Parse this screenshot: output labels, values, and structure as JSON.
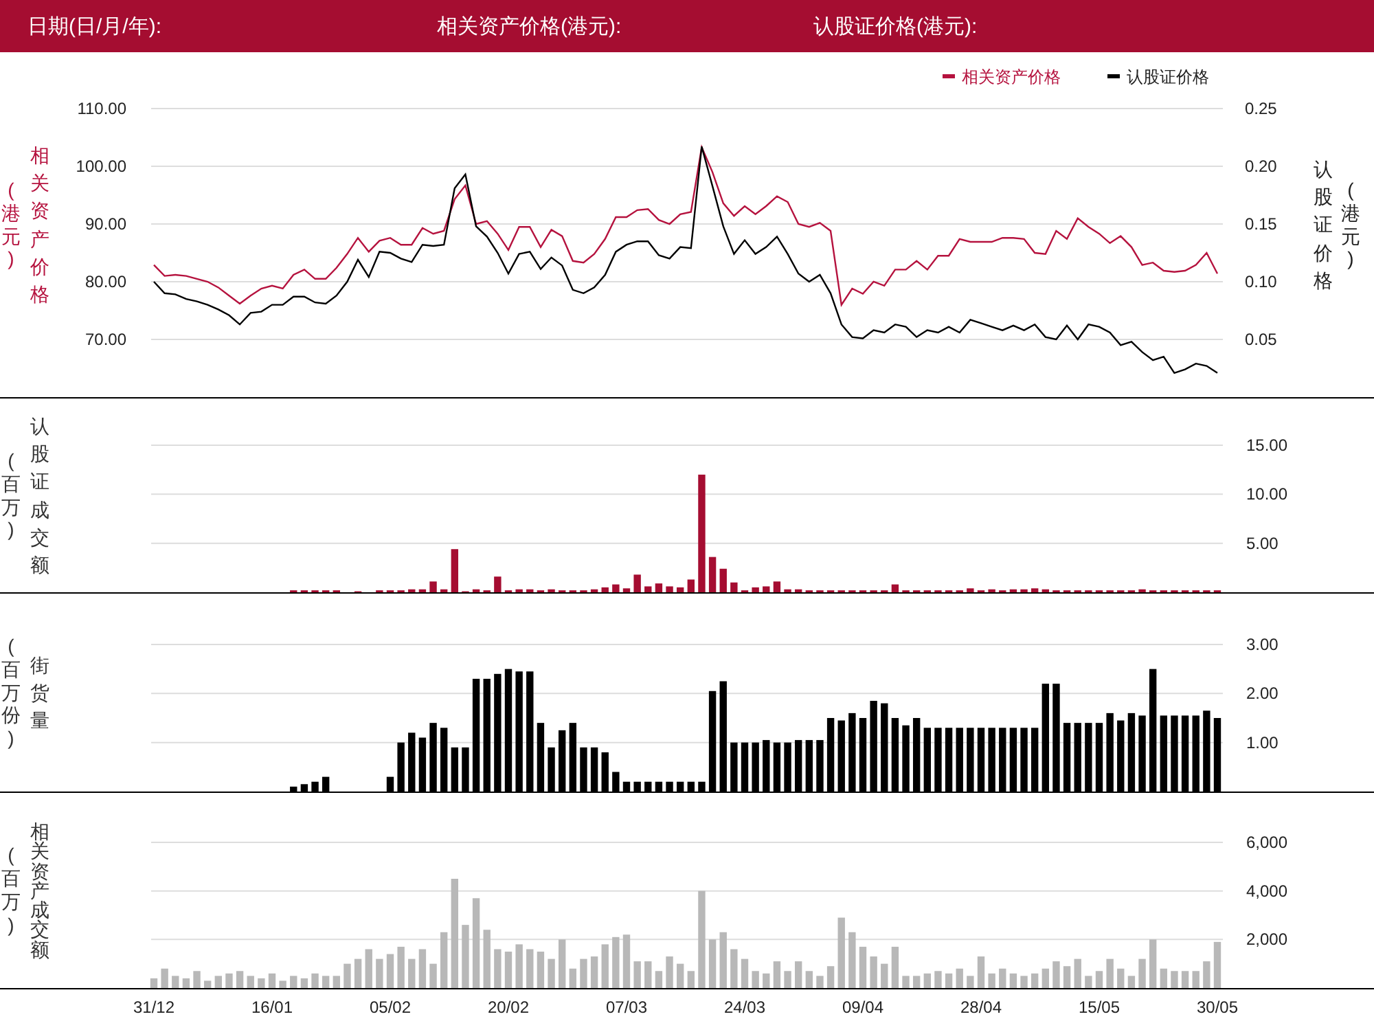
{
  "header": {
    "fields": [
      {
        "label": "日期(日/月/年):"
      },
      {
        "label": "相关资产价格(港元):"
      },
      {
        "label": "认股证价格(港元):"
      }
    ]
  },
  "panels": [
    {
      "left_unit": "(港元)",
      "right_unit": "(港元)",
      "chart_data": {
        "type": "line",
        "ylabel": "相关资产价格",
        "y2label": "认股证价格",
        "grid": true,
        "legend": true,
        "ylim": [
          60,
          110
        ],
        "y2lim": [
          0,
          0.25
        ],
        "yticks": [
          {
            "value": 70,
            "label": "70.00"
          },
          {
            "value": 80,
            "label": "80.00"
          },
          {
            "value": 90,
            "label": "90.00"
          },
          {
            "value": 100,
            "label": "100.00"
          },
          {
            "value": 110,
            "label": "110.00"
          }
        ],
        "y2ticks": [
          {
            "value": 0.05,
            "label": "0.05"
          },
          {
            "value": 0.1,
            "label": "0.10"
          },
          {
            "value": 0.15,
            "label": "0.15"
          },
          {
            "value": 0.2,
            "label": "0.20"
          },
          {
            "value": 0.25,
            "label": "0.25"
          }
        ],
        "series": [
          {
            "name": "相关资产价格",
            "color": "#b5123e",
            "values": [
              82.9,
              81.0,
              81.2,
              81.0,
              80.5,
              80.0,
              79.0,
              77.6,
              76.2,
              77.6,
              78.8,
              79.3,
              78.8,
              81.2,
              82.1,
              80.5,
              80.5,
              82.4,
              84.8,
              87.6,
              85.2,
              87.1,
              87.6,
              86.4,
              86.4,
              89.3,
              88.3,
              88.8,
              94.3,
              96.7,
              90.0,
              90.5,
              88.3,
              85.5,
              89.5,
              89.5,
              86.0,
              89.0,
              87.9,
              83.6,
              83.3,
              84.8,
              87.4,
              91.2,
              91.2,
              92.4,
              92.6,
              90.7,
              90.0,
              91.7,
              92.1,
              103.3,
              99.0,
              93.6,
              91.4,
              93.1,
              91.7,
              93.1,
              94.8,
              93.8,
              90.0,
              89.5,
              90.2,
              88.8,
              76.0,
              78.8,
              77.9,
              80.0,
              79.3,
              82.1,
              82.1,
              83.6,
              82.1,
              84.5,
              84.5,
              87.4,
              86.9,
              86.9,
              86.9,
              87.6,
              87.6,
              87.4,
              85.0,
              84.8,
              88.8,
              87.4,
              91.0,
              89.5,
              88.3,
              86.7,
              87.9,
              86.0,
              82.9,
              83.3,
              81.9,
              81.7,
              81.9,
              82.9,
              85.0,
              81.4
            ]
          },
          {
            "name": "认股证价格",
            "color": "#000000",
            "axis": "y2",
            "values": [
              0.1,
              0.09,
              0.089,
              0.085,
              0.083,
              0.08,
              0.076,
              0.071,
              0.063,
              0.073,
              0.074,
              0.08,
              0.08,
              0.087,
              0.087,
              0.082,
              0.081,
              0.088,
              0.1,
              0.119,
              0.104,
              0.126,
              0.125,
              0.12,
              0.117,
              0.132,
              0.131,
              0.132,
              0.181,
              0.193,
              0.148,
              0.139,
              0.125,
              0.107,
              0.124,
              0.126,
              0.111,
              0.121,
              0.114,
              0.093,
              0.09,
              0.095,
              0.106,
              0.126,
              0.132,
              0.135,
              0.135,
              0.123,
              0.12,
              0.13,
              0.129,
              0.217,
              0.183,
              0.148,
              0.124,
              0.136,
              0.124,
              0.13,
              0.139,
              0.124,
              0.107,
              0.1,
              0.106,
              0.09,
              0.063,
              0.052,
              0.051,
              0.058,
              0.056,
              0.063,
              0.061,
              0.052,
              0.058,
              0.056,
              0.061,
              0.056,
              0.067,
              0.064,
              0.061,
              0.058,
              0.062,
              0.058,
              0.063,
              0.052,
              0.05,
              0.062,
              0.05,
              0.063,
              0.061,
              0.056,
              0.045,
              0.048,
              0.039,
              0.032,
              0.035,
              0.021,
              0.024,
              0.029,
              0.027,
              0.021
            ]
          }
        ]
      }
    },
    {
      "left_unit": "(百万)",
      "chart_data": {
        "type": "bar",
        "ylabel": "认股证成交额",
        "grid": true,
        "ylim": [
          0,
          15
        ],
        "yticks": [
          {
            "value": 5,
            "label": "5.00"
          },
          {
            "value": 10,
            "label": "10.00"
          },
          {
            "value": 15,
            "label": "15.00"
          }
        ],
        "series": [
          {
            "color": "#a50d31",
            "values": [
              null,
              null,
              null,
              null,
              null,
              null,
              null,
              null,
              null,
              null,
              null,
              null,
              null,
              0.2,
              0.2,
              0.2,
              0.2,
              0.2,
              null,
              0.1,
              null,
              0.2,
              0.2,
              0.2,
              0.3,
              0.3,
              1.1,
              0.3,
              4.4,
              0.1,
              0.3,
              0.2,
              1.6,
              0.2,
              0.3,
              0.3,
              0.2,
              0.3,
              0.2,
              0.2,
              0.2,
              0.3,
              0.5,
              0.8,
              0.4,
              1.8,
              0.6,
              0.9,
              0.6,
              0.5,
              1.3,
              12.0,
              3.6,
              2.4,
              1.0,
              0.2,
              0.5,
              0.6,
              1.1,
              0.3,
              0.3,
              0.2,
              0.2,
              0.2,
              0.2,
              0.2,
              0.2,
              0.2,
              0.2,
              0.8,
              0.2,
              0.2,
              0.2,
              0.2,
              0.2,
              0.2,
              0.4,
              0.2,
              0.3,
              0.2,
              0.3,
              0.3,
              0.4,
              0.3,
              0.2,
              0.2,
              0.2,
              0.2,
              0.2,
              0.2,
              0.2,
              0.2,
              0.3,
              0.2,
              0.2,
              0.2,
              0.2,
              0.2,
              0.2,
              0.2
            ]
          }
        ]
      }
    },
    {
      "left_unit": "(百万份)",
      "chart_data": {
        "type": "bar",
        "ylabel": "街货量",
        "grid": true,
        "ylim": [
          0,
          3
        ],
        "yticks": [
          {
            "value": 1,
            "label": "1.00"
          },
          {
            "value": 2,
            "label": "2.00"
          },
          {
            "value": 3,
            "label": "3.00"
          }
        ],
        "series": [
          {
            "color": "#000000",
            "values": [
              null,
              null,
              null,
              null,
              null,
              null,
              null,
              null,
              null,
              null,
              null,
              null,
              null,
              0.1,
              0.15,
              0.2,
              0.3,
              null,
              null,
              null,
              null,
              null,
              0.3,
              1.0,
              1.2,
              1.1,
              1.4,
              1.3,
              0.9,
              0.9,
              2.3,
              2.3,
              2.4,
              2.5,
              2.45,
              2.45,
              1.4,
              0.9,
              1.25,
              1.4,
              0.9,
              0.9,
              0.8,
              0.4,
              0.2,
              0.2,
              0.2,
              0.2,
              0.2,
              0.2,
              0.2,
              0.2,
              2.05,
              2.25,
              1.0,
              1.0,
              1.0,
              1.05,
              1.0,
              1.0,
              1.05,
              1.05,
              1.05,
              1.5,
              1.45,
              1.6,
              1.5,
              1.85,
              1.8,
              1.5,
              1.35,
              1.5,
              1.3,
              1.3,
              1.3,
              1.3,
              1.3,
              1.3,
              1.3,
              1.3,
              1.3,
              1.3,
              1.3,
              2.2,
              2.2,
              1.4,
              1.4,
              1.4,
              1.4,
              1.6,
              1.45,
              1.6,
              1.55,
              2.5,
              1.55,
              1.55,
              1.55,
              1.55,
              1.65,
              1.5
            ]
          }
        ]
      }
    },
    {
      "left_unit": "(百万)",
      "chart_data": {
        "type": "bar",
        "ylabel": "相关资产成交额",
        "grid": true,
        "ylim": [
          0,
          6000
        ],
        "categories": [
          "31/12",
          null,
          null,
          null,
          null,
          null,
          null,
          null,
          null,
          null,
          null,
          "16/01",
          null,
          null,
          null,
          null,
          null,
          null,
          null,
          null,
          null,
          null,
          "05/02",
          null,
          null,
          null,
          null,
          null,
          null,
          null,
          null,
          null,
          null,
          "20/02",
          null,
          null,
          null,
          null,
          null,
          null,
          null,
          null,
          null,
          null,
          "07/03",
          null,
          null,
          null,
          null,
          null,
          null,
          null,
          null,
          null,
          null,
          "24/03",
          null,
          null,
          null,
          null,
          null,
          null,
          null,
          null,
          null,
          null,
          "09/04",
          null,
          null,
          null,
          null,
          null,
          null,
          null,
          null,
          null,
          null,
          "28/04",
          null,
          null,
          null,
          null,
          null,
          null,
          null,
          null,
          null,
          null,
          "15/05",
          null,
          null,
          null,
          null,
          null,
          null,
          null,
          null,
          null,
          null,
          "30/05"
        ],
        "yticks": [
          {
            "value": 2000,
            "label": "2,000"
          },
          {
            "value": 4000,
            "label": "4,000"
          },
          {
            "value": 6000,
            "label": "6,000"
          }
        ],
        "series": [
          {
            "color": "#b8b8b8",
            "values": [
              400,
              800,
              500,
              400,
              700,
              300,
              500,
              600,
              700,
              500,
              400,
              600,
              300,
              500,
              400,
              600,
              500,
              500,
              1000,
              1200,
              1600,
              1200,
              1400,
              1700,
              1200,
              1600,
              1000,
              2300,
              4500,
              2600,
              3700,
              2400,
              1600,
              1500,
              1800,
              1600,
              1500,
              1200,
              2000,
              800,
              1200,
              1300,
              1800,
              2100,
              2200,
              1100,
              1100,
              700,
              1300,
              1000,
              700,
              4000,
              2000,
              2300,
              1600,
              1200,
              700,
              600,
              1100,
              700,
              1100,
              700,
              500,
              900,
              2900,
              2300,
              1700,
              1300,
              1000,
              1700,
              500,
              500,
              600,
              700,
              600,
              800,
              500,
              1300,
              600,
              800,
              600,
              500,
              600,
              800,
              1100,
              900,
              1200,
              500,
              700,
              1200,
              800,
              500,
              1200,
              2000,
              800,
              700,
              700,
              700,
              1100,
              1900
            ]
          }
        ]
      }
    }
  ]
}
